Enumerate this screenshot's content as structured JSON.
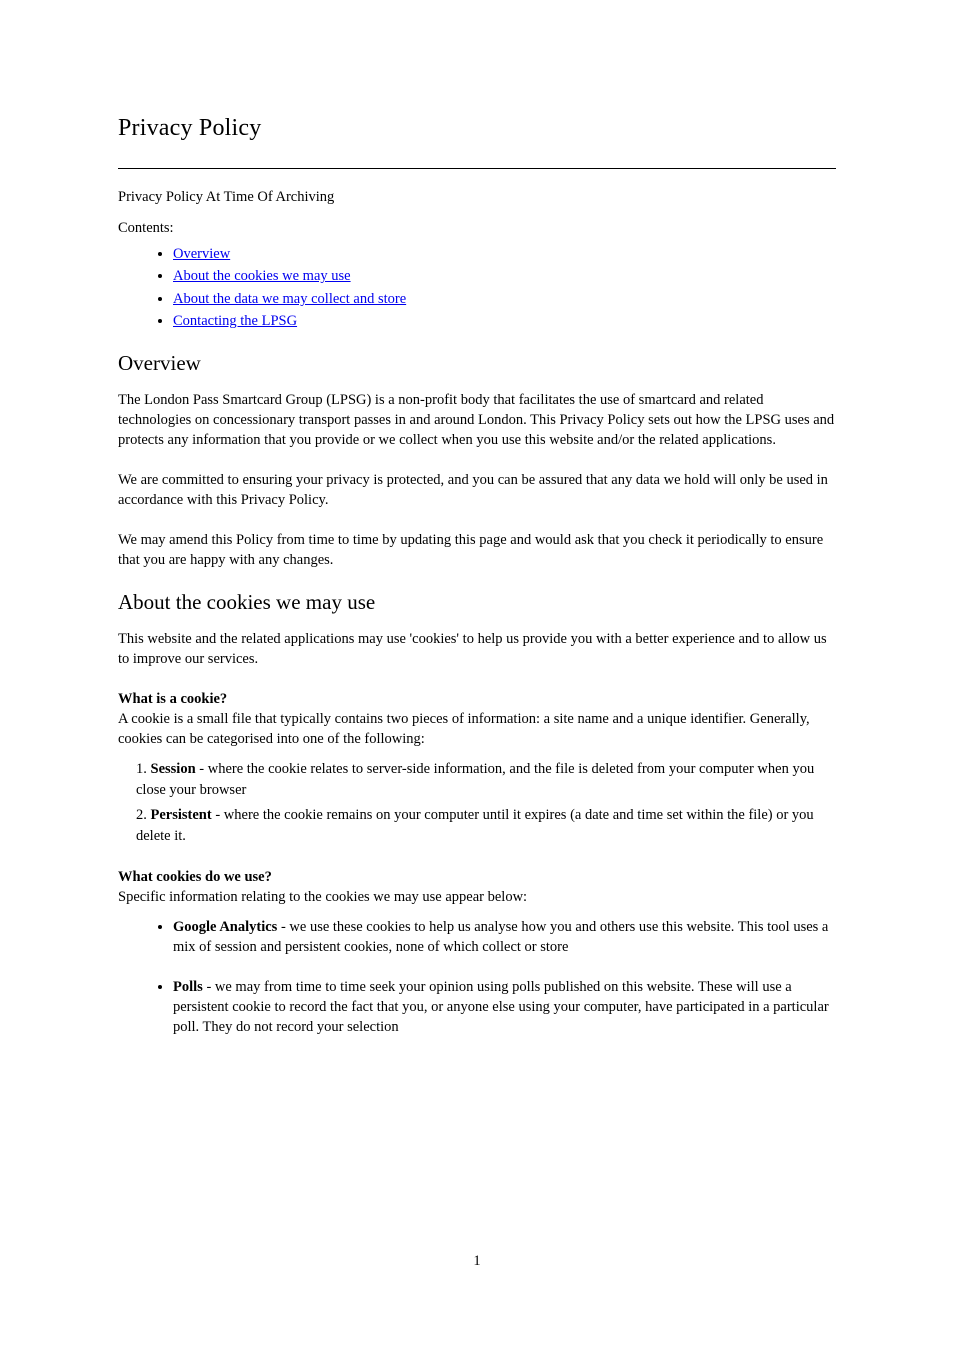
{
  "title": "Privacy Policy",
  "subtitle": "Privacy Policy At Time Of Archiving",
  "contentsLabel": "Contents:",
  "toc": [
    "Overview",
    "About the cookies we may use",
    "About the data we may collect and store",
    "Contacting the LPSG"
  ],
  "sections": {
    "overview": {
      "heading": "Overview",
      "paragraphs": [
        "The London Pass Smartcard Group (LPSG) is a non-profit body that facilitates the use of smartcard and related technologies on concessionary transport passes in and around London. This Privacy Policy sets out how the LPSG uses and protects any information that you provide or we collect when you use this website and/or the related applications.",
        "We are committed to ensuring your privacy is protected, and you can be assured that any data we hold will only be used in accordance with this Privacy Policy.",
        "We may amend this Policy from time to time by updating this page and would ask that you check it periodically to ensure that you are happy with any changes."
      ]
    },
    "cookies": {
      "heading": "About the cookies we may use",
      "intro": "This website and the related applications may use 'cookies' to help us provide you with a better experience and to allow us to improve our services.",
      "whatIs": {
        "lead": "A cookie is a small file that typically contains two pieces of information: a site name and a unique identifier. Generally, cookies can be categorised into one of the following:",
        "items": [
          {
            "num": "1. ",
            "bold": "Session",
            "rest": " - where the cookie relates to server-side information, and the file is deleted from your computer when you close your browser"
          },
          {
            "num": "2. ",
            "bold": "Persistent",
            "rest": " - where the cookie remains on your computer until it expires (a date and time set within the file) or you delete it."
          }
        ]
      },
      "ourCookiesIntro": "Specific information relating to the cookies we may use appear below:",
      "ourCookies": [
        {
          "bold": "Google Analytics",
          "rest": " - we use these cookies to help us analyse how you and others use this website. This tool uses a mix of session and persistent cookies, none of which collect or store"
        },
        {
          "bold": "Polls",
          "rest": " - we may from time to time seek your opinion using polls published on this website. These will use a persistent cookie to record the fact that you, or anyone else using your computer, have participated in a particular poll. They do not record your selection"
        }
      ]
    }
  },
  "pageNumber": "1"
}
